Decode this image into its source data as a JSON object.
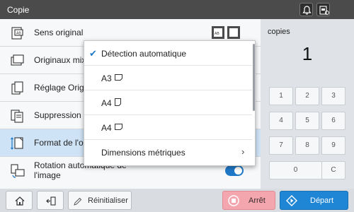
{
  "header": {
    "title": "Copie",
    "buttons": [
      {
        "icon": "bell-icon"
      },
      {
        "icon": "device-status-icon"
      }
    ]
  },
  "settings": {
    "rows": [
      {
        "label": "Sens original",
        "icon": "original-direction-icon"
      },
      {
        "label": "Originaux mixt",
        "icon": "mixed-originals-icon"
      },
      {
        "label": "Réglage Origin",
        "icon": "original-setting-icon"
      },
      {
        "label": "Suppression p",
        "icon": "page-suppression-icon"
      },
      {
        "label": "Format de l'ori",
        "icon": "original-format-icon",
        "selected": true
      },
      {
        "label": "Rotation automatique de l'image",
        "icon": "auto-rotate-icon",
        "toggle_on": true
      }
    ]
  },
  "dropdown": {
    "options": [
      {
        "label": "Détection automatique",
        "checked": true
      },
      {
        "label": "A3",
        "paper": "landscape"
      },
      {
        "label": "A4",
        "paper": "portrait"
      },
      {
        "label": "A4",
        "paper": "landscape"
      },
      {
        "label": "Dimensions métriques",
        "has_submenu": true
      }
    ]
  },
  "copies": {
    "label": "copies",
    "value": "1",
    "keys": [
      "1",
      "2",
      "3",
      "4",
      "5",
      "6",
      "7",
      "8",
      "9",
      "0",
      "C"
    ]
  },
  "footer": {
    "home_icon": "home-icon",
    "back_icon": "job-back-icon",
    "reset_label": "Réinitialiser",
    "stop_label": "Arrêt",
    "start_label": "Départ"
  },
  "colors": {
    "accent": "#1e78c8",
    "topbar": "#4b4b4b",
    "stop": "#f3a6ae",
    "start": "#1f86d6",
    "selected_row": "#cfe3f6"
  }
}
